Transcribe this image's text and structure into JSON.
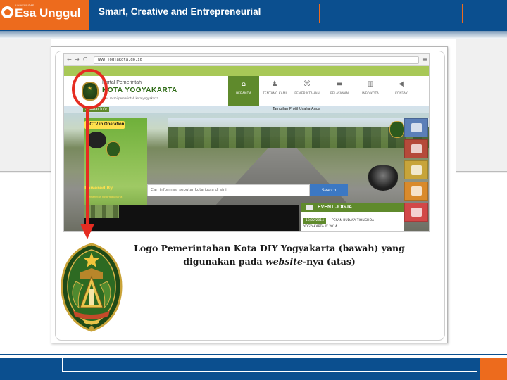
{
  "slide_header": {
    "logo_small": "UNIVERSITAS",
    "logo_name": "Esa Unggul",
    "tagline": "Smart, Creative and Entrepreneurial"
  },
  "browser": {
    "nav_back": "←",
    "nav_forward": "→",
    "nav_reload": "C",
    "url": "www.jogjakota.go.id",
    "menu_glyph": "≡"
  },
  "site": {
    "title_small": "Portal Pemerintah",
    "title_big": "KOTA YOGYAKARTA",
    "subtitle": "situs resmi pemerintah kota yogyakarta",
    "nav": [
      {
        "label": "BERANDA",
        "icon": "home-icon",
        "glyph": "⌂"
      },
      {
        "label": "TENTANG KAMI",
        "icon": "person-icon",
        "glyph": "♟"
      },
      {
        "label": "PEMERINTAHAN",
        "icon": "building-icon",
        "glyph": "⌘"
      },
      {
        "label": "PELAYANAN",
        "icon": "car-icon",
        "glyph": "▬"
      },
      {
        "label": "INFO KOTA",
        "icon": "chart-icon",
        "glyph": "▥"
      },
      {
        "label": "KONTAK",
        "icon": "megaphone-icon",
        "glyph": "◀"
      }
    ],
    "cctv_label": "Seputar Info",
    "hero_caption": "Tampilan Profil Usaha Anda",
    "cctv_operation": "CCTV in Operation",
    "powered_by": "Powered By",
    "powered_sub": "Pemerintah Kota Yogyakarta",
    "search_placeholder": "Cari informasi seputar kota jogja di sini",
    "search_button": "Search",
    "event_title": "EVENT JOGJA",
    "event_date": "10/02/2014",
    "event_text": "PEKAN BUDAYA TIONGHOA",
    "event_text2": "YOGYAKARTA IX 2014",
    "side_icons": [
      {
        "name": "cube-icon",
        "color": "#5b7fb8"
      },
      {
        "name": "book-icon",
        "color": "#b54a3a"
      },
      {
        "name": "folder-icon",
        "color": "#c7a43a"
      },
      {
        "name": "document-icon",
        "color": "#d98a2c"
      },
      {
        "name": "mail-icon",
        "color": "#d24848"
      }
    ]
  },
  "caption": {
    "line1": "Logo Pemerintahan Kota DIY Yogyakarta (bawah) yang",
    "line2_pre": "digunakan pada ",
    "line2_em": "website",
    "line2_post": "-nya (atas)"
  },
  "colors": {
    "brand_blue": "#0b4f8f",
    "brand_orange": "#ed6b1d",
    "highlight_red": "#e52c21",
    "site_green": "#5f8a2c"
  }
}
